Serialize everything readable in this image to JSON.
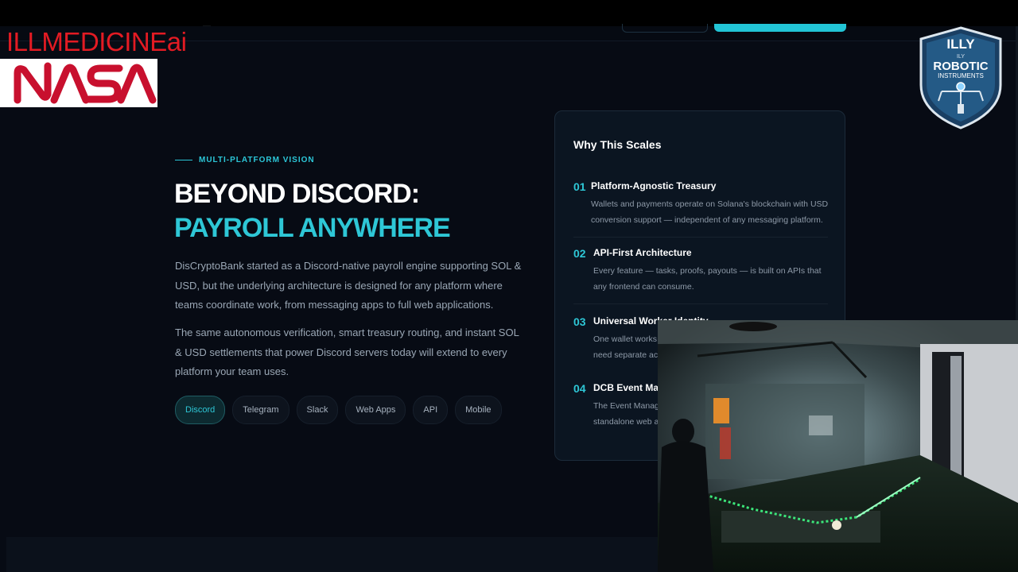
{
  "overlays": {
    "brand_text": "ILLMEDICINEai",
    "nasa_logo": "NASA",
    "badge": {
      "top": "ILLY",
      "small": "ILY",
      "middle": "ROBOTIC",
      "bottom": "INSTRUMENTS"
    }
  },
  "hero": {
    "eyebrow": "MULTI-PLATFORM VISION",
    "title_line1": "BEYOND DISCORD:",
    "title_line2": "PAYROLL ANYWHERE",
    "paragraph1": "DisCryptoBank started as a Discord-native payroll engine supporting SOL & USD, but the underlying architecture is designed for any platform where teams coordinate work, from messaging apps to full web applications.",
    "paragraph2": "The same autonomous verification, smart treasury routing, and instant SOL & USD settlements that power Discord servers today will extend to every platform your team uses.",
    "chips": [
      {
        "label": "Discord",
        "active": true
      },
      {
        "label": "Telegram",
        "active": false
      },
      {
        "label": "Slack",
        "active": false
      },
      {
        "label": "Web Apps",
        "active": false
      },
      {
        "label": "API",
        "active": false
      },
      {
        "label": "Mobile",
        "active": false
      }
    ]
  },
  "card": {
    "title": "Why This Scales",
    "items": [
      {
        "num": "01",
        "title": "Platform-Agnostic Treasury",
        "desc": "Wallets and payments operate on Solana's blockchain with USD conversion support — independent of any messaging platform."
      },
      {
        "num": "02",
        "title": "API-First Architecture",
        "desc": "Every feature — tasks, proofs, payouts — is built on APIs that any frontend can consume."
      },
      {
        "num": "03",
        "title": "Universal Worker Identity",
        "desc": "One wallet works a need separate acc"
      },
      {
        "num": "04",
        "title": "DCB Event Mana",
        "desc": "The Event Manage standalone web ap"
      }
    ]
  },
  "colors": {
    "accent": "#2ec7d6",
    "background": "#070b14",
    "card": "#0b1521",
    "brand_red": "#e31b23"
  }
}
